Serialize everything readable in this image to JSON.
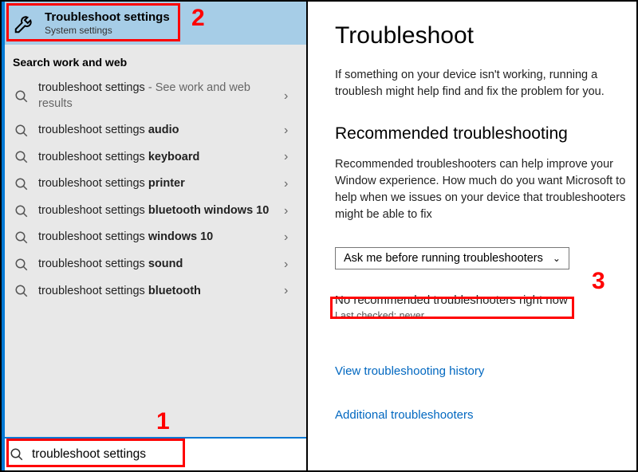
{
  "left": {
    "top_result": {
      "title": "Troubleshoot settings",
      "subtitle": "System settings"
    },
    "section_label": "Search work and web",
    "rows": [
      {
        "prefix": "troubleshoot settings",
        "bold": "",
        "suffix": " - See work and web results"
      },
      {
        "prefix": "troubleshoot settings ",
        "bold": "audio",
        "suffix": ""
      },
      {
        "prefix": "troubleshoot settings ",
        "bold": "keyboard",
        "suffix": ""
      },
      {
        "prefix": "troubleshoot settings ",
        "bold": "printer",
        "suffix": ""
      },
      {
        "prefix": "troubleshoot settings ",
        "bold": "bluetooth windows 10",
        "suffix": ""
      },
      {
        "prefix": "troubleshoot settings ",
        "bold": "windows 10",
        "suffix": ""
      },
      {
        "prefix": "troubleshoot settings ",
        "bold": "sound",
        "suffix": ""
      },
      {
        "prefix": "troubleshoot settings ",
        "bold": "bluetooth",
        "suffix": ""
      }
    ],
    "search_value": "troubleshoot settings"
  },
  "right": {
    "title": "Troubleshoot",
    "desc": "If something on your device isn't working, running a troublesh might help find and fix the problem for you.",
    "section": "Recommended troubleshooting",
    "section_desc": "Recommended troubleshooters can help improve your Window experience. How much do you want Microsoft to help when we issues on your device that troubleshooters might be able to fix",
    "dropdown": "Ask me before running troubleshooters",
    "no_rec": "No recommended troubleshooters right now",
    "last_checked": "Last checked: never",
    "link_history": "View troubleshooting history",
    "link_additional": "Additional troubleshooters"
  },
  "annotations": {
    "n1": "1",
    "n2": "2",
    "n3": "3"
  },
  "chevron": "›",
  "dd_chevron": "⌄"
}
